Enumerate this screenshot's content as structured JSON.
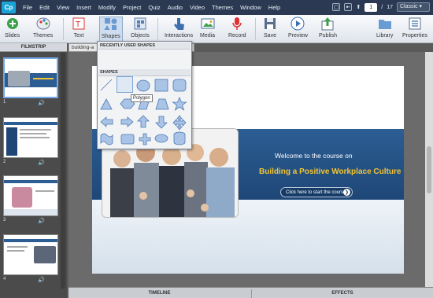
{
  "app": {
    "logo": "Cp"
  },
  "menu": [
    "File",
    "Edit",
    "View",
    "Insert",
    "Modify",
    "Project",
    "Quiz",
    "Audio",
    "Video",
    "Themes",
    "Window",
    "Help"
  ],
  "slide_nav": {
    "current": "1",
    "separator": "/",
    "total": "17"
  },
  "workspace": "Classic",
  "toolbar": {
    "slides": "Slides",
    "themes": "Themes",
    "text": "Text",
    "shapes": "Shapes",
    "objects": "Objects",
    "interactions": "Interactions",
    "media": "Media",
    "record": "Record",
    "save": "Save",
    "preview": "Preview",
    "publish": "Publish",
    "library": "Library",
    "properties": "Properties"
  },
  "filmstrip": {
    "header": "FILMSTRIP",
    "thumbs": [
      {
        "num": "1",
        "audio_icon": "speaker-icon"
      },
      {
        "num": "2",
        "audio_icon": "speaker-icon"
      },
      {
        "num": "3",
        "audio_icon": "speaker-icon"
      },
      {
        "num": "4",
        "audio_icon": "speaker-icon"
      }
    ]
  },
  "document_tab": {
    "label": "building-a",
    "close": "×"
  },
  "shapes_panel": {
    "recent_header": "RECENTLY USED SHAPES",
    "shapes_header": "SHAPES",
    "tooltip": "Polygon"
  },
  "slide": {
    "welcome": "Welcome to the course on",
    "course_title": "Building a Positive Workplace Culture",
    "start_button": "Click here to start the course",
    "start_arrow": "❯"
  },
  "bottom_tabs": {
    "timeline": "TIMELINE",
    "effects": "EFFECTS"
  },
  "colors": {
    "menubar": "#2b3a52",
    "banner": "#2c5d93",
    "accent_yellow": "#f4c531"
  }
}
